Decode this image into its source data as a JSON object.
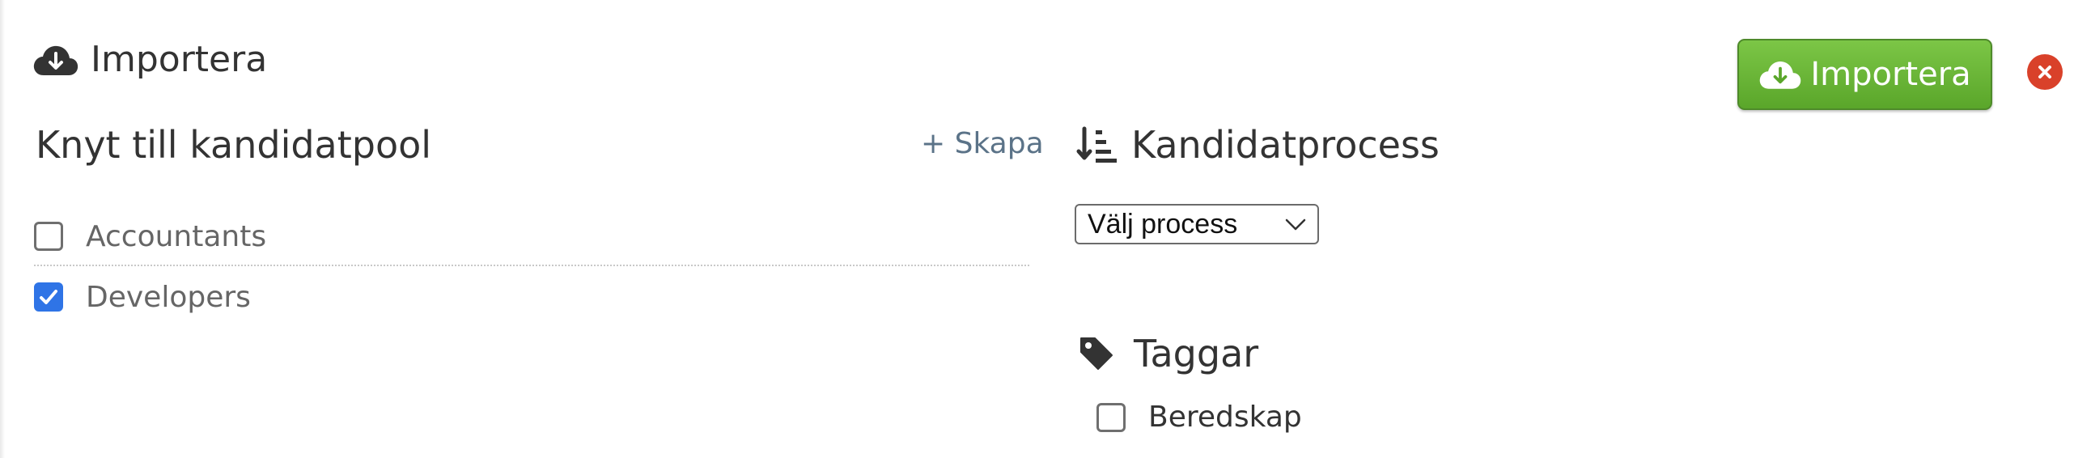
{
  "header": {
    "title": "Importera",
    "icon": "cloud-download-icon"
  },
  "actions": {
    "import_label": "Importera",
    "import_icon": "cloud-download-icon",
    "close_icon": "close-icon",
    "import_color": "#6db43a",
    "close_color": "#d9412a"
  },
  "pool": {
    "title": "Knyt till kandidatpool",
    "create_label": "+ Skapa",
    "items": [
      {
        "label": "Accountants",
        "checked": false
      },
      {
        "label": "Developers",
        "checked": true
      }
    ],
    "checked_color": "#2f74e6"
  },
  "process": {
    "title": "Kandidatprocess",
    "icon": "sort-descending-icon",
    "select_value": "Välj process"
  },
  "tags": {
    "title": "Taggar",
    "icon": "tag-icon",
    "items": [
      {
        "label": "Beredskap",
        "checked": false
      }
    ]
  }
}
